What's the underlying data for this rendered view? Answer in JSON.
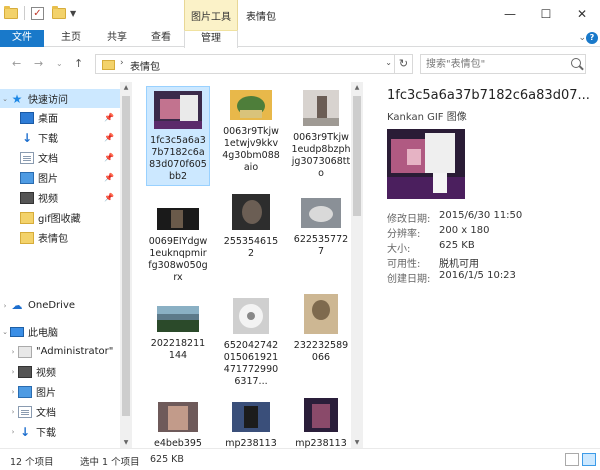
{
  "titlebar": {
    "context_tab": "图片工具",
    "window_title": "表情包",
    "minimize": "—",
    "maximize": "☐",
    "close": "✕"
  },
  "ribbon": {
    "tabs": [
      {
        "label": "文件"
      },
      {
        "label": "主页"
      },
      {
        "label": "共享"
      },
      {
        "label": "查看"
      },
      {
        "label": "管理"
      }
    ],
    "help": "?"
  },
  "address": {
    "path": "表情包",
    "search_placeholder": "搜索\"表情包\""
  },
  "nav": {
    "items": [
      {
        "label": "快速访问",
        "icon": "star-icon"
      },
      {
        "label": "桌面",
        "icon": "desktop-icon"
      },
      {
        "label": "下载",
        "icon": "download-icon"
      },
      {
        "label": "文档",
        "icon": "document-icon"
      },
      {
        "label": "图片",
        "icon": "pictures-icon"
      },
      {
        "label": "视频",
        "icon": "video-icon"
      },
      {
        "label": "gif图收藏",
        "icon": "folder-icon"
      },
      {
        "label": "表情包",
        "icon": "folder-icon"
      },
      {
        "label": "OneDrive",
        "icon": "cloud-icon"
      },
      {
        "label": "此电脑",
        "icon": "computer-icon"
      },
      {
        "label": "\"Administrator\"",
        "icon": "user-folder-icon"
      },
      {
        "label": "视频",
        "icon": "video-icon"
      },
      {
        "label": "图片",
        "icon": "pictures-icon"
      },
      {
        "label": "文档",
        "icon": "document-icon"
      },
      {
        "label": "下载",
        "icon": "download-icon"
      }
    ]
  },
  "files": [
    {
      "name": "1fc3c5a6a37b7182c6a83d070f605bb2"
    },
    {
      "name": "0063r9Tkjw1etwjv9kkv4g30bm088aio"
    },
    {
      "name": "0063r9Tkjw1eudp8bzphjg3073068tto"
    },
    {
      "name": "0069EIYdgw1euknqpmirfg308w050grx"
    },
    {
      "name": "2553546152"
    },
    {
      "name": "6225357727"
    },
    {
      "name": "202218211144"
    },
    {
      "name": "652042742015061921471772990631​7..."
    },
    {
      "name": "232232589066"
    },
    {
      "name": "e4beb395"
    },
    {
      "name": "mp238113"
    },
    {
      "name": "mp238113"
    }
  ],
  "details": {
    "title": "1fc3c5a6a37b7182c6a83d07...",
    "type": "Kankan GIF 图像",
    "props": [
      {
        "key": "修改日期:",
        "value": "2015/6/30 11:50"
      },
      {
        "key": "分辨率:",
        "value": "200 x 180"
      },
      {
        "key": "大小:",
        "value": "625 KB"
      },
      {
        "key": "可用性:",
        "value": "脱机可用"
      },
      {
        "key": "创建日期:",
        "value": "2016/1/5 10:23"
      }
    ]
  },
  "status": {
    "count": "12 个项目",
    "selected": "选中 1 个项目",
    "size": "625 KB"
  }
}
